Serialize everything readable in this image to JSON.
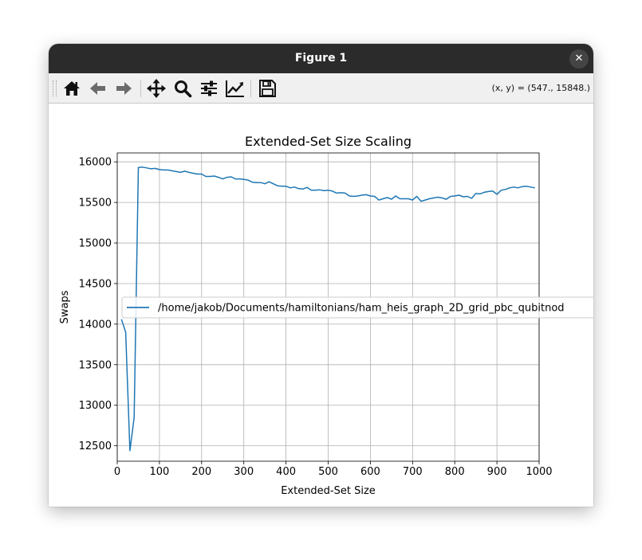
{
  "window": {
    "title": "Figure 1",
    "close_label": "✕"
  },
  "toolbar": {
    "buttons": [
      {
        "icon": "home-icon",
        "label": "Home"
      },
      {
        "icon": "back-arrow-icon",
        "label": "Back"
      },
      {
        "icon": "forward-arrow-icon",
        "label": "Forward"
      },
      {
        "icon": "pan-move-icon",
        "label": "Pan"
      },
      {
        "icon": "zoom-magnifier-icon",
        "label": "Zoom"
      },
      {
        "icon": "subplots-sliders-icon",
        "label": "Configure subplots"
      },
      {
        "icon": "edit-axis-curve-icon",
        "label": "Edit axis"
      },
      {
        "icon": "save-floppy-icon",
        "label": "Save"
      }
    ],
    "coords": "(x, y) = (547., 15848.)"
  },
  "chart_data": {
    "type": "line",
    "title": "Extended-Set Size Scaling",
    "xlabel": "Extended-Set Size",
    "ylabel": "Swaps",
    "xlim": [
      0,
      1000
    ],
    "ylim": [
      12310,
      16110
    ],
    "xticks": [
      0,
      100,
      200,
      300,
      400,
      500,
      600,
      700,
      800,
      900,
      1000
    ],
    "yticks": [
      12500,
      13000,
      13500,
      14000,
      14500,
      15000,
      15500,
      16000
    ],
    "grid": true,
    "legend_position": "center-left",
    "series": [
      {
        "name": "/home/jakob/Documents/hamiltonians/ham_heis_graph_2D_grid_pbc_qubitnod",
        "color": "#1f77b4",
        "x": [
          10,
          20,
          30,
          40,
          50,
          60,
          70,
          80,
          90,
          100,
          110,
          120,
          130,
          140,
          150,
          160,
          170,
          180,
          190,
          200,
          210,
          220,
          230,
          240,
          250,
          260,
          270,
          280,
          290,
          300,
          310,
          320,
          330,
          340,
          350,
          360,
          370,
          380,
          390,
          400,
          410,
          420,
          430,
          440,
          450,
          460,
          470,
          480,
          490,
          500,
          510,
          520,
          530,
          540,
          550,
          560,
          570,
          580,
          590,
          600,
          610,
          620,
          630,
          640,
          650,
          660,
          670,
          680,
          690,
          700,
          710,
          720,
          730,
          740,
          750,
          760,
          770,
          780,
          790,
          800,
          810,
          820,
          830,
          840,
          850,
          860,
          870,
          880,
          890,
          900,
          910,
          920,
          930,
          940,
          950,
          960,
          970,
          980,
          990
        ],
        "y": [
          14060,
          13900,
          12440,
          12850,
          15930,
          15935,
          15925,
          15915,
          15920,
          15905,
          15900,
          15900,
          15890,
          15880,
          15870,
          15885,
          15870,
          15860,
          15850,
          15850,
          15820,
          15820,
          15825,
          15810,
          15790,
          15810,
          15815,
          15790,
          15790,
          15785,
          15775,
          15750,
          15745,
          15745,
          15730,
          15755,
          15730,
          15705,
          15700,
          15700,
          15680,
          15690,
          15670,
          15665,
          15685,
          15650,
          15650,
          15655,
          15645,
          15650,
          15640,
          15615,
          15620,
          15615,
          15580,
          15575,
          15580,
          15590,
          15595,
          15580,
          15575,
          15530,
          15545,
          15560,
          15540,
          15580,
          15545,
          15545,
          15545,
          15530,
          15575,
          15515,
          15530,
          15545,
          15555,
          15565,
          15555,
          15540,
          15575,
          15580,
          15590,
          15570,
          15575,
          15550,
          15610,
          15605,
          15625,
          15635,
          15640,
          15600,
          15650,
          15660,
          15680,
          15690,
          15680,
          15695,
          15700,
          15690,
          15680
        ]
      }
    ]
  }
}
